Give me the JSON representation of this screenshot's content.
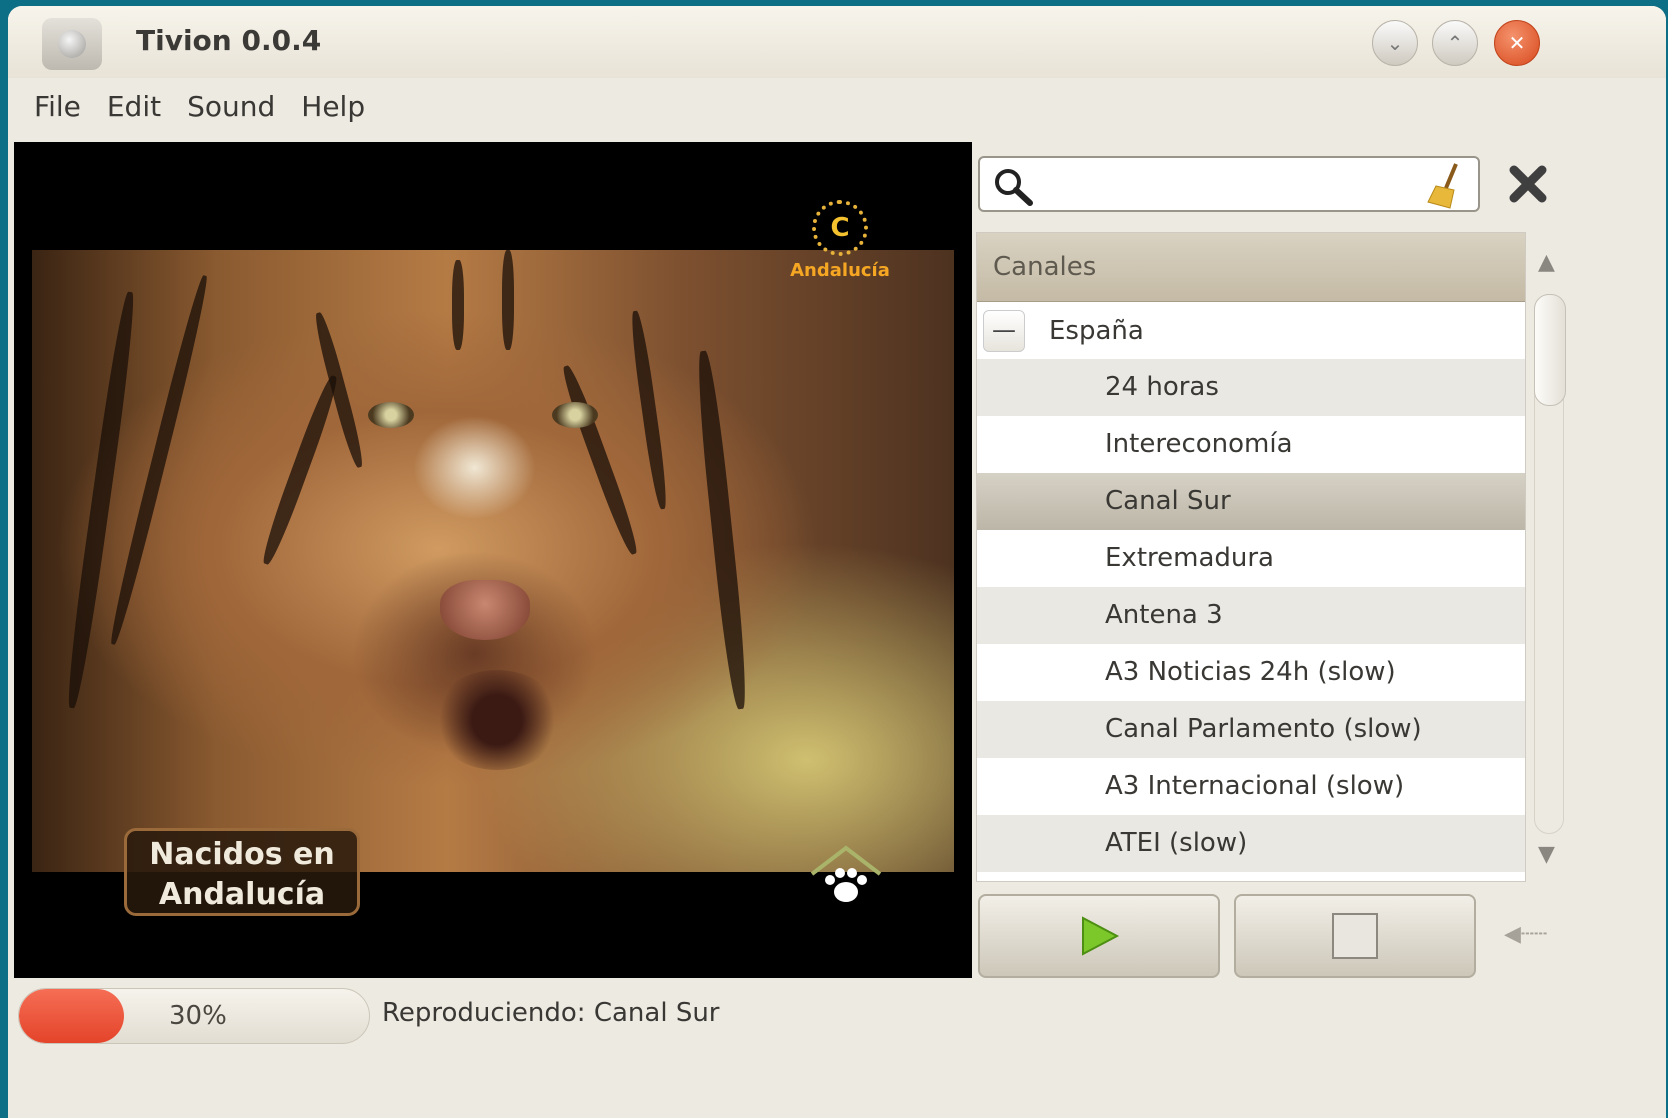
{
  "window": {
    "title": "Tivion 0.0.4"
  },
  "menu": [
    "File",
    "Edit",
    "Sound",
    "Help"
  ],
  "video": {
    "channel_logo_letter": "C",
    "channel_logo_text": "Andalucía",
    "caption_line1": "Nacidos en",
    "caption_line2": "Andalucía"
  },
  "search": {
    "value": "",
    "placeholder": ""
  },
  "channels": {
    "header": "Canales",
    "group": {
      "label": "España",
      "expander": "—"
    },
    "items": [
      "24 horas",
      "Intereconomía",
      "Canal Sur",
      "Extremadura",
      "Antena 3",
      "A3 Noticias 24h (slow)",
      "Canal Parlamento (slow)",
      "A3 Internacional (slow)",
      "ATEI (slow)"
    ],
    "selected_index": 2
  },
  "status": {
    "progress": 0.3,
    "progress_label": "30%",
    "text": "Reproduciendo: Canal Sur"
  },
  "colors": {
    "accent_progress": "#e4442a",
    "play_green": "#7cc72a",
    "desktop": "#0d6f86"
  },
  "icons": {
    "search": "magnifier",
    "clear": "broom",
    "close": "x-mark",
    "play": "triangle-right",
    "stop": "square",
    "volume": "speaker"
  }
}
